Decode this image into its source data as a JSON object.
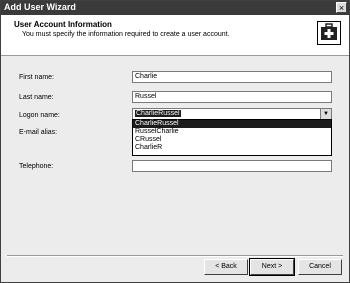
{
  "window": {
    "title": "Add User Wizard",
    "close_glyph": "×"
  },
  "header": {
    "title": "User Account Information",
    "subtitle": "You must specify the information required to create a user account.",
    "icon": "wizard-first-aid-icon"
  },
  "form": {
    "first_name_label": "First name:",
    "first_name_value": "Charlie",
    "last_name_label": "Last name:",
    "last_name_value": "Russel",
    "logon_name_label": "Logon name:",
    "logon_name_value": "CharlieRussel",
    "email_label": "E-mail alias:",
    "telephone_label": "Telephone:",
    "telephone_value": ""
  },
  "logon_options": [
    "CharlieRussel",
    "RusselCharlie",
    "CRussel",
    "CharlieR"
  ],
  "buttons": {
    "back": "< Back",
    "next": "Next >",
    "cancel": "Cancel"
  }
}
